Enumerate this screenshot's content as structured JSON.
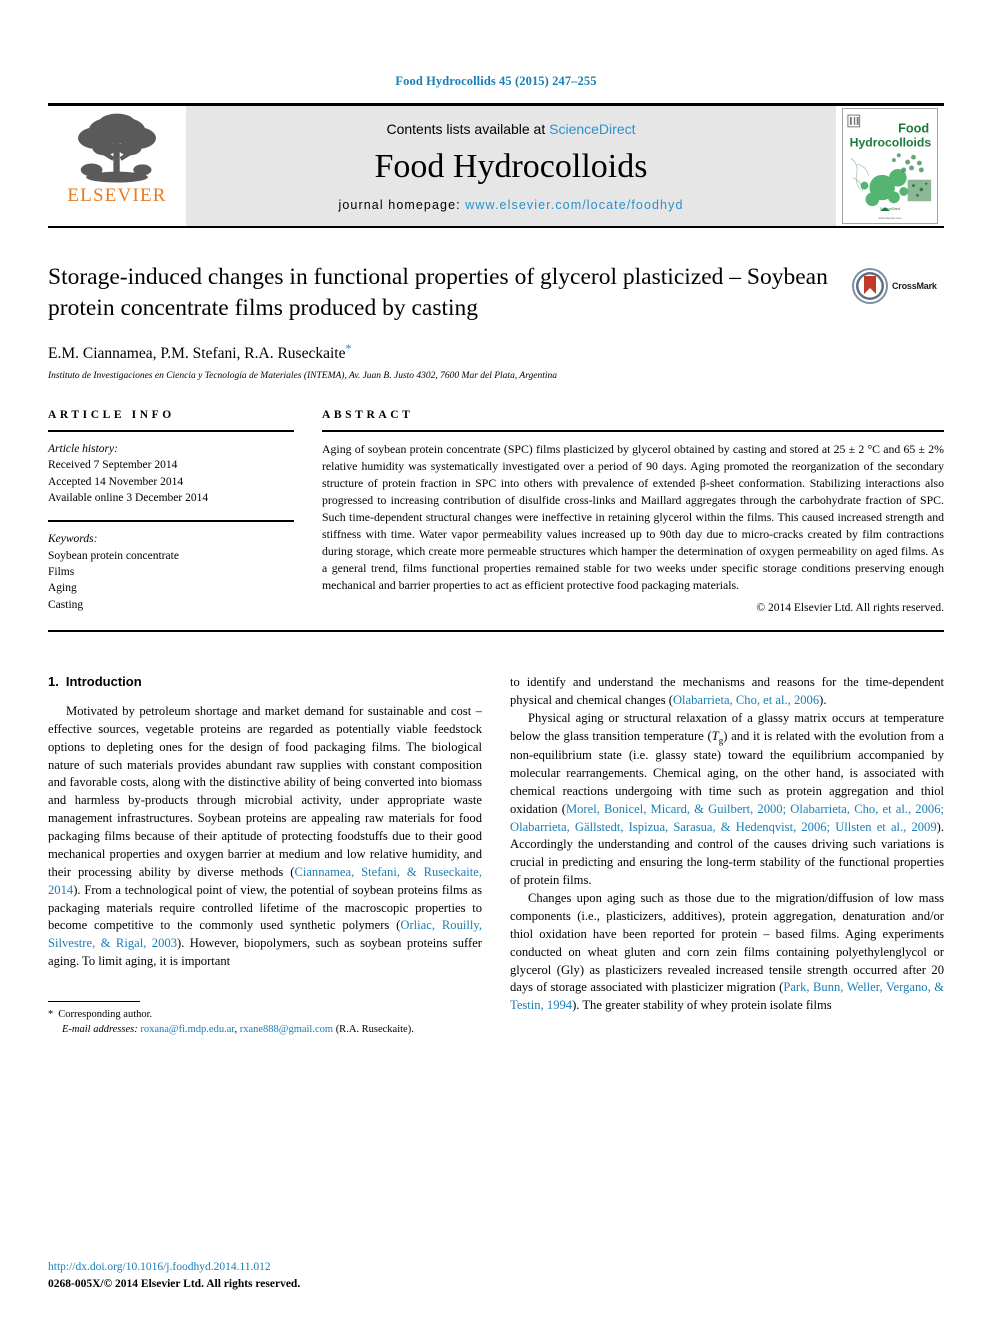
{
  "running_head": "Food Hydrocollids 45 (2015) 247–255",
  "masthead": {
    "publisher_name": "ELSEVIER",
    "contents_prefix": "Contents lists available at ",
    "contents_link": "ScienceDirect",
    "journal_title": "Food Hydrocolloids",
    "homepage_prefix": "journal homepage: ",
    "homepage_url": "www.elsevier.com/locate/foodhyd",
    "cover_title_line1": "Food",
    "cover_title_line2": "Hydrocolloids",
    "cover_accent_color": "#1e7a3c"
  },
  "article": {
    "title": "Storage-induced changes in functional properties of glycerol plasticized – Soybean protein concentrate films produced by casting",
    "crossmark_label": "CrossMark",
    "authors": "E.M. Ciannamea, P.M. Stefani, R.A. Ruseckaite",
    "corresponding_marker": "*",
    "affiliation": "Instituto de Investigaciones en Ciencia y Tecnología de Materiales (INTEMA), Av. Juan B. Justo 4302, 7600 Mar del Plata, Argentina"
  },
  "article_info": {
    "heading": "ARTICLE INFO",
    "history_label": "Article history:",
    "history": [
      "Received 7 September 2014",
      "Accepted 14 November 2014",
      "Available online 3 December 2014"
    ],
    "keywords_label": "Keywords:",
    "keywords": [
      "Soybean protein concentrate",
      "Films",
      "Aging",
      "Casting"
    ]
  },
  "abstract": {
    "heading": "ABSTRACT",
    "text": "Aging of soybean protein concentrate (SPC) films plasticized by glycerol obtained by casting and stored at 25 ± 2 °C and 65 ± 2% relative humidity was systematically investigated over a period of 90 days. Aging promoted the reorganization of the secondary structure of protein fraction in SPC into others with prevalence of extended β-sheet conformation. Stabilizing interactions also progressed to increasing contribution of disulfide cross-links and Maillard aggregates through the carbohydrate fraction of SPC. Such time-dependent structural changes were ineffective in retaining glycerol within the films. This caused increased strength and stiffness with time. Water vapor permeability values increased up to 90th day due to micro-cracks created by film contractions during storage, which create more permeable structures which hamper the determination of oxygen permeability on aged films. As a general trend, films functional properties remained stable for two weeks under specific storage conditions preserving enough mechanical and barrier properties to act as efficient protective food packaging materials.",
    "copyright": "© 2014 Elsevier Ltd. All rights reserved."
  },
  "introduction": {
    "number": "1.",
    "heading": "Introduction",
    "left_p1_a": "Motivated by petroleum shortage and market demand for sustainable and cost – effective sources, vegetable proteins are regarded as potentially viable feedstock options to depleting ones for the design of food packaging films. The biological nature of such materials provides abundant raw supplies with constant composition and favorable costs, along with the distinctive ability of being converted into biomass and harmless by-products through microbial activity, under appropriate waste management infrastructures. Soybean proteins are appealing raw materials for food packaging films because of their aptitude of protecting foodstuffs due to their good mechanical properties and oxygen barrier at medium and low relative humidity, and their processing ability by diverse methods (",
    "left_cite1": "Ciannamea, Stefani, & Ruseckaite, 2014",
    "left_p1_b": "). From a technological point of view, the potential of soybean proteins films as packaging materials require controlled lifetime of the macroscopic properties to become competitive to the commonly used synthetic polymers (",
    "left_cite2": "Orliac, Rouilly, Silvestre, & Rigal, 2003",
    "left_p1_c": "). However, biopolymers, such as soybean proteins suffer aging. To limit aging, it is important",
    "right_p1_a": "to identify and understand the mechanisms and reasons for the time-dependent physical and chemical changes (",
    "right_cite1": "Olabarrieta, Cho, et al., 2006",
    "right_p1_b": ").",
    "right_p2_a": "Physical aging or structural relaxation of a glassy matrix occurs at temperature below the glass transition temperature (",
    "right_p2_tg": "T",
    "right_p2_tg_sub": "g",
    "right_p2_b": ") and it is related with the evolution from a non-equilibrium state (i.e. glassy state) toward the equilibrium accompanied by molecular rearrangements. Chemical aging, on the other hand, is associated with chemical reactions undergoing with time such as protein aggregation and thiol oxidation (",
    "right_cite2": "Morel, Bonicel, Micard, & Guilbert, 2000; Olabarrieta, Cho, et al., 2006; Olabarrieta, Gällstedt, Ispizua, Sarasua, & Hedenqvist, 2006; Ullsten et al., 2009",
    "right_p2_c": "). Accordingly the understanding and control of the causes driving such variations is crucial in predicting and ensuring the long-term stability of the functional properties of protein films.",
    "right_p3_a": "Changes upon aging such as those due to the migration/diffusion of low mass components (i.e., plasticizers, additives), protein aggregation, denaturation and/or thiol oxidation have been reported for protein – based films. Aging experiments conducted on wheat gluten and corn zein films containing polyethylenglycol or glycerol (Gly) as plasticizers revealed increased tensile strength occurred after 20 days of storage associated with plasticizer migration (",
    "right_cite3": "Park, Bunn, Weller, Vergano, & Testin, 1994",
    "right_p3_b": "). The greater stability of whey protein isolate films"
  },
  "footnote": {
    "marker": "*",
    "corresponding": "Corresponding author.",
    "email_label": "E-mail addresses:",
    "email1": "roxana@fi.mdp.edu.ar",
    "email_sep": ", ",
    "email2": "rxane888@gmail.com",
    "email_suffix": " (R.A. Ruseckaite)."
  },
  "page_footer": {
    "doi": "http://dx.doi.org/10.1016/j.foodhyd.2014.11.012",
    "issn": "0268-005X/© 2014 Elsevier Ltd. All rights reserved."
  },
  "colors": {
    "link": "#1a7eb5",
    "sciencedirect": "#2a92c9",
    "elsevier_orange": "#e87b1e",
    "crossmark_red": "#c0392b"
  }
}
